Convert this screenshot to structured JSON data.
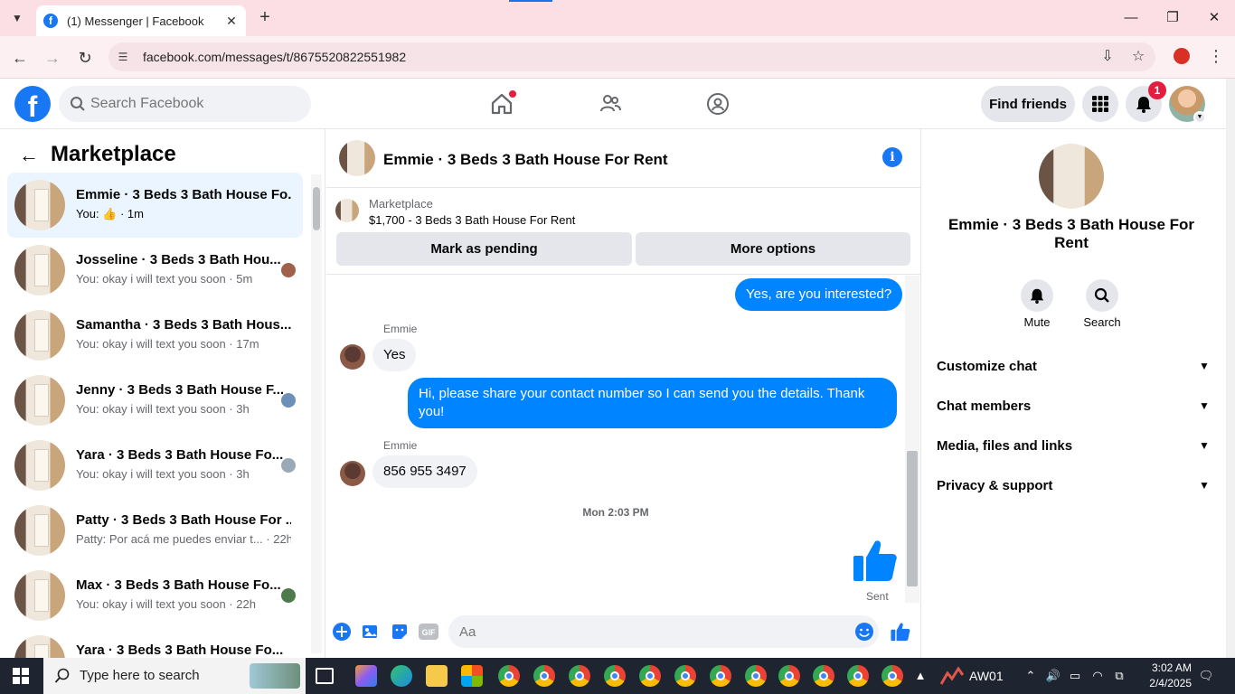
{
  "browser": {
    "tab_title": "(1) Messenger | Facebook",
    "tab_favicon": "f",
    "url": "facebook.com/messages/t/8675520822551982"
  },
  "fb": {
    "search_placeholder": "Search Facebook",
    "find_friends": "Find friends",
    "notification_count": "1"
  },
  "left": {
    "title": "Marketplace",
    "conversations": [
      {
        "name": "Emmie · 3 Beds 3 Bath House Fo...",
        "sub": "You: 👍 · 1m"
      },
      {
        "name": "Josseline · 3 Beds 3 Bath Hou...",
        "sub": "You: okay i will text you soon · 5m"
      },
      {
        "name": "Samantha · 3 Beds 3 Bath Hous...",
        "sub": "You: okay i will text you soon · 17m"
      },
      {
        "name": "Jenny · 3 Beds 3 Bath House F...",
        "sub": "You: okay i will text you soon · 3h"
      },
      {
        "name": "Yara · 3 Beds 3 Bath House Fo...",
        "sub": "You: okay i will text you soon · 3h"
      },
      {
        "name": "Patty · 3 Beds 3 Bath House For ...",
        "sub": "Patty: Por acá me puedes enviar t... · 22h"
      },
      {
        "name": "Max · 3 Beds 3 Bath House Fo...",
        "sub": "You: okay i will text you soon · 22h"
      },
      {
        "name": "Yara · 3 Beds 3 Bath House Fo...",
        "sub": ""
      }
    ]
  },
  "chat": {
    "title": "Emmie · 3 Beds 3 Bath House For Rent",
    "marketplace_label": "Marketplace",
    "listing": "$1,700 - 3 Beds 3 Bath House For Rent",
    "mark_pending": "Mark as pending",
    "more_options": "More options",
    "messages": {
      "out1": "Yes, are you interested?",
      "sender1": "Emmie",
      "in1": "Yes",
      "out2": "Hi, please share your contact number so I can send you the details. Thank you!",
      "sender2": "Emmie",
      "in2": "856 955 3497",
      "timestamp": "Mon 2:03 PM",
      "sent": "Sent"
    },
    "composer_placeholder": "Aa"
  },
  "right": {
    "name": "Emmie · 3 Beds 3 Bath House For Rent",
    "mute": "Mute",
    "search": "Search",
    "sections": [
      "Customize chat",
      "Chat members",
      "Media, files and links",
      "Privacy & support"
    ]
  },
  "taskbar": {
    "search_placeholder": "Type here to search",
    "stock": "AW01",
    "time": "3:02 AM",
    "date": "2/4/2025"
  },
  "colors": {
    "accent": "#1877f2",
    "bubble_out": "#0084ff",
    "tab_bar": "#fcdfe4"
  }
}
